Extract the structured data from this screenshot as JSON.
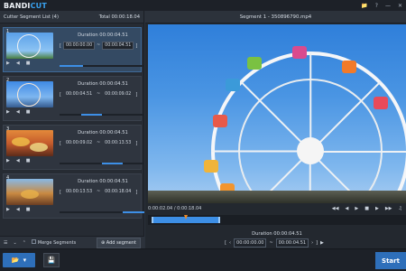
{
  "app": {
    "logo_main": "BANDI",
    "logo_accent": "CUT"
  },
  "titlebar": {
    "icons": [
      "folder-icon",
      "question-icon",
      "minimize-icon",
      "close-icon"
    ]
  },
  "left_panel": {
    "title": "Cutter Segment List (4)",
    "total_label": "Total 00:00:18.04",
    "segments": [
      {
        "num": "1",
        "duration": "Duration 00:00:04.51",
        "start": "00:00:00.00",
        "end": "00:00:04.51"
      },
      {
        "num": "2",
        "duration": "Duration 00:00:04.51",
        "start": "00:00:04.51",
        "end": "00:00:09.02"
      },
      {
        "num": "3",
        "duration": "Duration 00:00:04.51",
        "start": "00:00:09.02",
        "end": "00:00:13.53"
      },
      {
        "num": "4",
        "duration": "Duration 00:00:04.51",
        "start": "00:00:13.53",
        "end": "00:00:18.04"
      }
    ],
    "separator": "~",
    "merge_label": "Merge Segments",
    "add_label": "Add segment"
  },
  "right_panel": {
    "title": "Segment 1 - 350896790.mp4",
    "time_display": "0:00:02.04 / 0:00:18.04",
    "duration": "Duration 00:00:04.51",
    "start": "00:00:00.00",
    "end": "00:00:04.51",
    "separator": "~"
  },
  "bottom": {
    "start_label": "Start"
  },
  "colors": {
    "accent": "#2e6fba",
    "highlight": "#3d8fe6",
    "playhead": "#f08a24"
  }
}
